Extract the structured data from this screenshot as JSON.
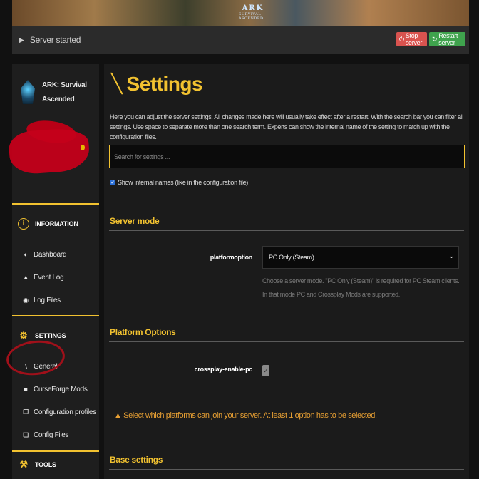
{
  "banner": {
    "logo_big": "ARK",
    "logo_small": "SURVIVAL ASCENDED"
  },
  "status": {
    "text": "Server started",
    "stop_label": "Stop server",
    "restart_label": "Restart server"
  },
  "sidebar": {
    "server_name": "ARK: Survival Ascended",
    "sections": [
      {
        "title": "INFORMATION",
        "items": [
          {
            "label": "Dashboard"
          },
          {
            "label": "Event Log"
          },
          {
            "label": "Log Files"
          }
        ]
      },
      {
        "title": "SETTINGS",
        "items": [
          {
            "label": "General"
          },
          {
            "label": "CurseForge Mods"
          },
          {
            "label": "Configuration profiles"
          },
          {
            "label": "Config Files"
          }
        ]
      },
      {
        "title": "TOOLS",
        "items": []
      }
    ]
  },
  "main": {
    "title": "Settings",
    "description": "Here you can adjust the server settings. All changes made here will usually take effect after a restart. With the search bar you can filter all settings. Use space to separate more than one search term. Experts can show the internal name of the setting to match up with the configuration files.",
    "search_placeholder": "Search for settings ...",
    "show_internal_label": "Show internal names (like in the configuration file)",
    "groups": [
      {
        "title": "Server mode"
      },
      {
        "title": "Platform Options"
      },
      {
        "title": "Base settings"
      }
    ],
    "platform_label": "platformoption",
    "platform_value": "PC Only (Steam)",
    "platform_hint": "Choose a server mode. \"PC Only (Steam)\" is required for PC Steam clients. In that mode PC and Crossplay Mods are supported.",
    "crossplay_label": "crossplay-enable-pc",
    "warning": "Select which platforms can join your server. At least 1 option has to be selected."
  },
  "colors": {
    "accent": "#f2c230",
    "stop": "#d9534f",
    "restart": "#3fa34d",
    "annotation": "#a0101a"
  }
}
